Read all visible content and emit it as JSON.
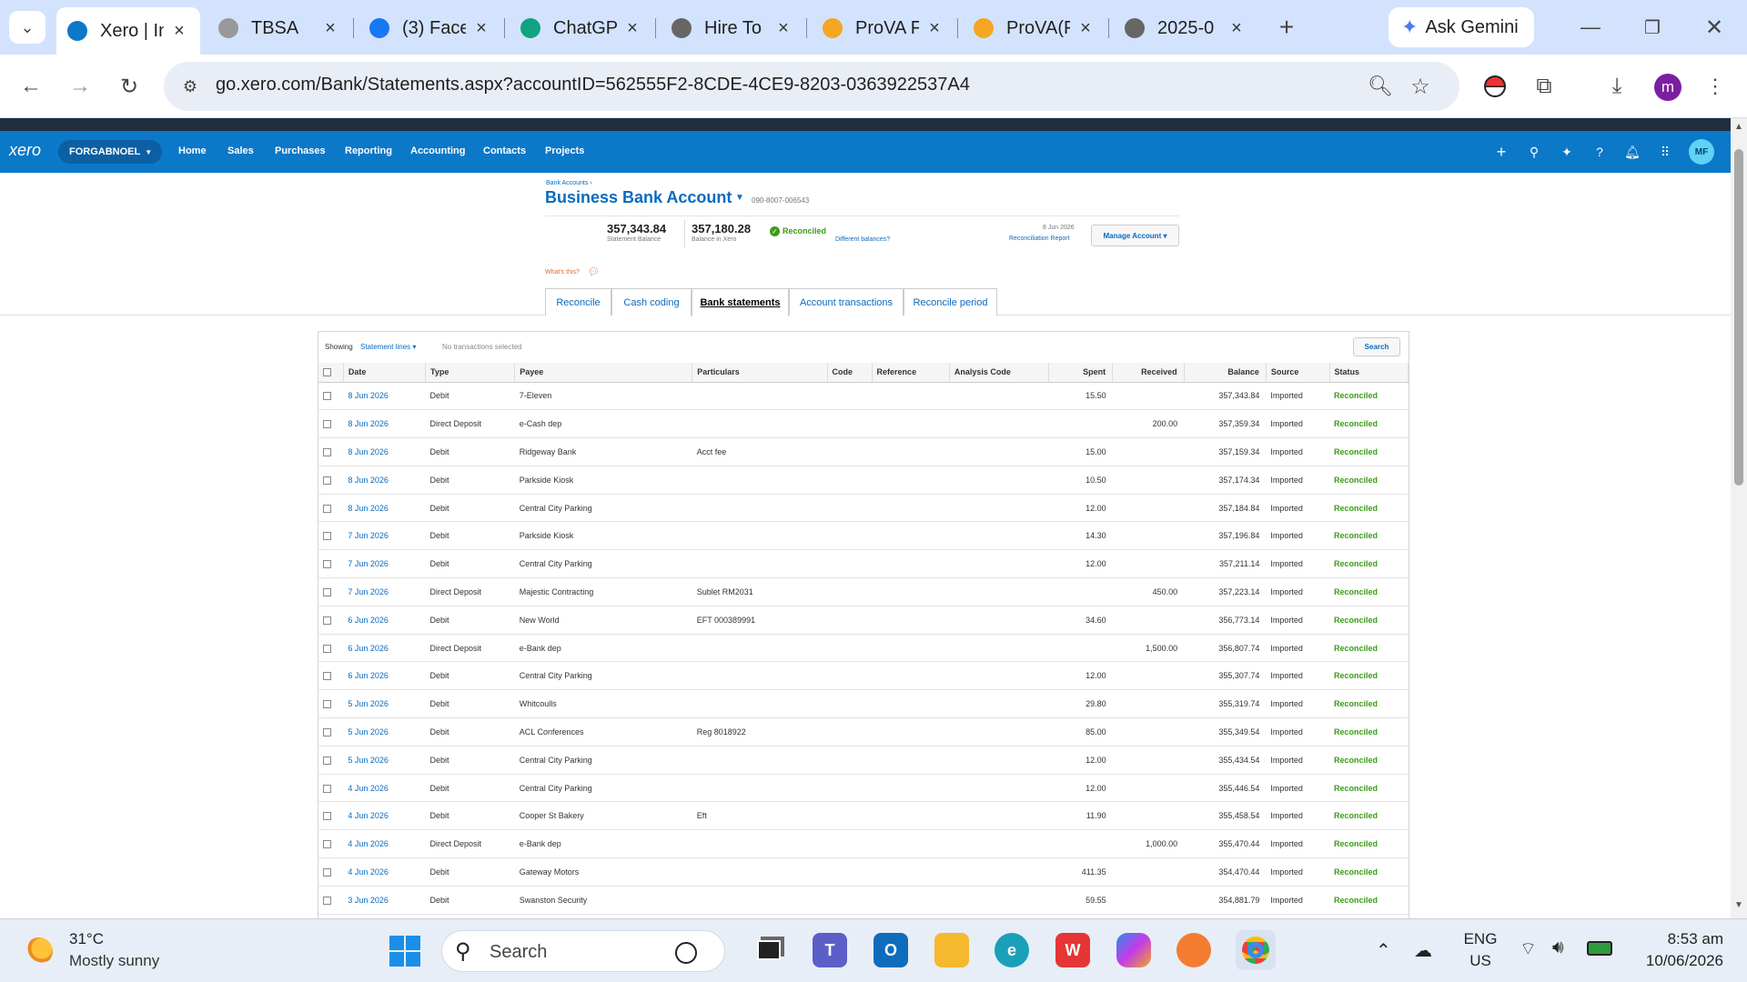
{
  "browser": {
    "tabs": [
      {
        "title": "Xero | In",
        "active": true
      },
      {
        "title": "TBSA",
        "active": false
      },
      {
        "title": "(3) Face",
        "active": false
      },
      {
        "title": "ChatGP",
        "active": false
      },
      {
        "title": "Hire To",
        "active": false
      },
      {
        "title": "ProVA F",
        "active": false
      },
      {
        "title": "ProVA(F",
        "active": false
      },
      {
        "title": "2025-0",
        "active": false
      }
    ],
    "gemini_label": "Ask Gemini",
    "url": "go.xero.com/Bank/Statements.aspx?accountID=562555F2-8CDE-4CE9-8203-0363922537A4",
    "profile_initial": "m"
  },
  "xero": {
    "logo": "xero",
    "org_name": "FORGABNOEL",
    "nav": [
      "Home",
      "Sales",
      "Purchases",
      "Reporting",
      "Accounting",
      "Contacts",
      "Projects"
    ],
    "user_initials": "MF",
    "breadcrumb": "Bank Accounts ›",
    "account_title": "Business Bank Account",
    "account_number": "090-8007-006543",
    "statement_balance": "357,343.84",
    "statement_balance_label": "Statement Balance",
    "xero_balance": "357,180.28",
    "xero_balance_label": "Balance in Xero",
    "reconciled_label": "Reconciled",
    "different_balances": "Different balances?",
    "recon_date": "8 Jun 2026",
    "recon_report": "Reconciliation Report",
    "manage_account": "Manage Account ▾",
    "whats_this": "What's this?",
    "tabs": [
      "Reconcile",
      "Cash coding",
      "Bank statements",
      "Account transactions",
      "Reconcile period"
    ],
    "showing_label": "Showing",
    "showing_value": "Statement lines ▾",
    "no_selected": "No transactions selected",
    "search_button": "Search",
    "columns": [
      "Date",
      "Type",
      "Payee",
      "Particulars",
      "Code",
      "Reference",
      "Analysis Code",
      "Spent",
      "Received",
      "Balance",
      "Source",
      "Status"
    ],
    "rows": [
      [
        "8 Jun 2026",
        "Debit",
        "7-Eleven",
        "",
        "",
        "",
        "",
        "15.50",
        "",
        "357,343.84",
        "Imported",
        "Reconciled"
      ],
      [
        "8 Jun 2026",
        "Direct Deposit",
        "e-Cash dep",
        "",
        "",
        "",
        "",
        "",
        "200.00",
        "357,359.34",
        "Imported",
        "Reconciled"
      ],
      [
        "8 Jun 2026",
        "Debit",
        "Ridgeway Bank",
        "Acct fee",
        "",
        "",
        "",
        "15.00",
        "",
        "357,159.34",
        "Imported",
        "Reconciled"
      ],
      [
        "8 Jun 2026",
        "Debit",
        "Parkside Kiosk",
        "",
        "",
        "",
        "",
        "10.50",
        "",
        "357,174.34",
        "Imported",
        "Reconciled"
      ],
      [
        "8 Jun 2026",
        "Debit",
        "Central City Parking",
        "",
        "",
        "",
        "",
        "12.00",
        "",
        "357,184.84",
        "Imported",
        "Reconciled"
      ],
      [
        "7 Jun 2026",
        "Debit",
        "Parkside Kiosk",
        "",
        "",
        "",
        "",
        "14.30",
        "",
        "357,196.84",
        "Imported",
        "Reconciled"
      ],
      [
        "7 Jun 2026",
        "Debit",
        "Central City Parking",
        "",
        "",
        "",
        "",
        "12.00",
        "",
        "357,211.14",
        "Imported",
        "Reconciled"
      ],
      [
        "7 Jun 2026",
        "Direct Deposit",
        "Majestic Contracting",
        "Sublet RM2031",
        "",
        "",
        "",
        "",
        "450.00",
        "357,223.14",
        "Imported",
        "Reconciled"
      ],
      [
        "6 Jun 2026",
        "Debit",
        "New World",
        "EFT 000389991",
        "",
        "",
        "",
        "34.60",
        "",
        "356,773.14",
        "Imported",
        "Reconciled"
      ],
      [
        "6 Jun 2026",
        "Direct Deposit",
        "e-Bank dep",
        "",
        "",
        "",
        "",
        "",
        "1,500.00",
        "356,807.74",
        "Imported",
        "Reconciled"
      ],
      [
        "6 Jun 2026",
        "Debit",
        "Central City Parking",
        "",
        "",
        "",
        "",
        "12.00",
        "",
        "355,307.74",
        "Imported",
        "Reconciled"
      ],
      [
        "5 Jun 2026",
        "Debit",
        "Whitcoulls",
        "",
        "",
        "",
        "",
        "29.80",
        "",
        "355,319.74",
        "Imported",
        "Reconciled"
      ],
      [
        "5 Jun 2026",
        "Debit",
        "ACL Conferences",
        "Reg 8018922",
        "",
        "",
        "",
        "85.00",
        "",
        "355,349.54",
        "Imported",
        "Reconciled"
      ],
      [
        "5 Jun 2026",
        "Debit",
        "Central City Parking",
        "",
        "",
        "",
        "",
        "12.00",
        "",
        "355,434.54",
        "Imported",
        "Reconciled"
      ],
      [
        "4 Jun 2026",
        "Debit",
        "Central City Parking",
        "",
        "",
        "",
        "",
        "12.00",
        "",
        "355,446.54",
        "Imported",
        "Reconciled"
      ],
      [
        "4 Jun 2026",
        "Debit",
        "Cooper St Bakery",
        "Eft",
        "",
        "",
        "",
        "11.90",
        "",
        "355,458.54",
        "Imported",
        "Reconciled"
      ],
      [
        "4 Jun 2026",
        "Direct Deposit",
        "e-Bank dep",
        "",
        "",
        "",
        "",
        "",
        "1,000.00",
        "355,470.44",
        "Imported",
        "Reconciled"
      ],
      [
        "4 Jun 2026",
        "Debit",
        "Gateway Motors",
        "",
        "",
        "",
        "",
        "411.35",
        "",
        "354,470.44",
        "Imported",
        "Reconciled"
      ],
      [
        "3 Jun 2026",
        "Debit",
        "Swanston Security",
        "",
        "",
        "",
        "",
        "59.55",
        "",
        "354,881.79",
        "Imported",
        "Reconciled"
      ]
    ]
  },
  "taskbar": {
    "temperature": "31°C",
    "weather": "Mostly sunny",
    "search_placeholder": "Search",
    "lang_top": "ENG",
    "lang_bottom": "US",
    "time": "8:53 am",
    "date": "10/06/2026"
  },
  "colors": {
    "xero_blue": "#0b78c8",
    "reconciled_green": "#3c9c18",
    "link_blue": "#0b6bbf"
  }
}
